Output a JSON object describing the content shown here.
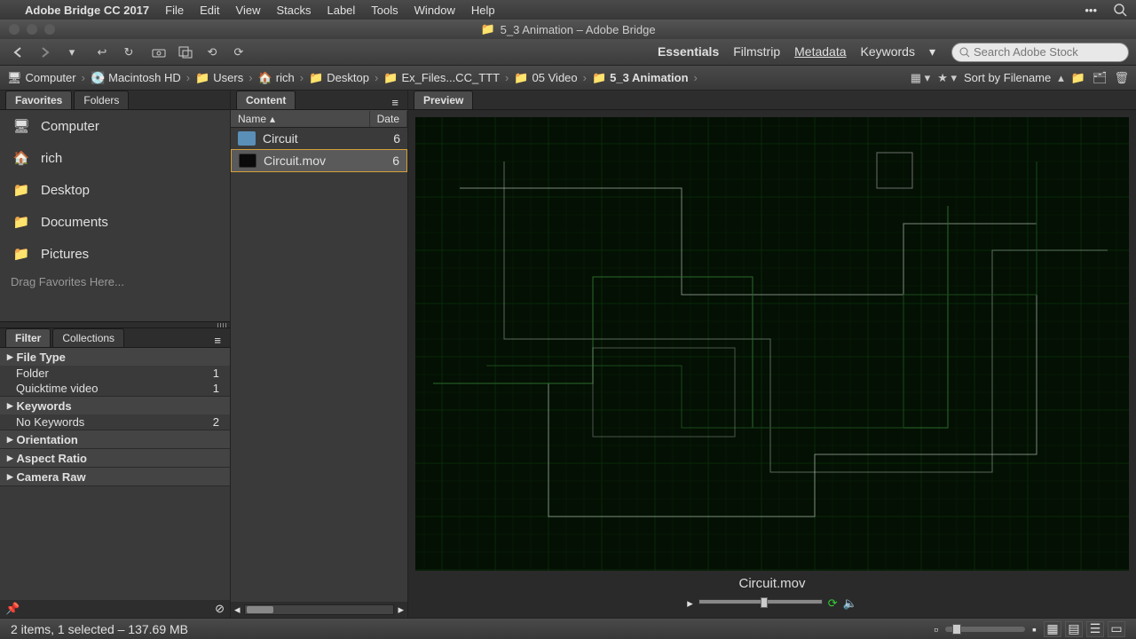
{
  "menubar": {
    "app": "Adobe Bridge CC 2017",
    "items": [
      "File",
      "Edit",
      "View",
      "Stacks",
      "Label",
      "Tools",
      "Window",
      "Help"
    ]
  },
  "titlebar": {
    "folder": "5_3 Animation",
    "app": "Adobe Bridge"
  },
  "workspaces": [
    "Essentials",
    "Filmstrip",
    "Metadata",
    "Keywords"
  ],
  "active_workspace": "Essentials",
  "search": {
    "placeholder": "Search Adobe Stock"
  },
  "breadcrumb": [
    {
      "icon": "display-icon",
      "label": "Computer"
    },
    {
      "icon": "drive-icon",
      "label": "Macintosh HD"
    },
    {
      "icon": "folder-icon",
      "label": "Users"
    },
    {
      "icon": "home-icon",
      "label": "rich"
    },
    {
      "icon": "folder-icon",
      "label": "Desktop"
    },
    {
      "icon": "folder-icon",
      "label": "Ex_Files...CC_TTT"
    },
    {
      "icon": "folder-icon",
      "label": "05 Video"
    },
    {
      "icon": "folder-icon",
      "label": "5_3 Animation"
    }
  ],
  "sort_label": "Sort by Filename",
  "panels": {
    "favorites": {
      "tabs": [
        "Favorites",
        "Folders"
      ],
      "active": "Favorites"
    },
    "filter": {
      "tabs": [
        "Filter",
        "Collections"
      ],
      "active": "Filter"
    },
    "content": {
      "tabs": [
        "Content"
      ],
      "active": "Content"
    },
    "preview": {
      "tabs": [
        "Preview"
      ],
      "active": "Preview"
    }
  },
  "favorites_items": [
    {
      "icon": "display-icon",
      "label": "Computer"
    },
    {
      "icon": "home-icon",
      "label": "rich"
    },
    {
      "icon": "folder-icon",
      "label": "Desktop"
    },
    {
      "icon": "folder-icon",
      "label": "Documents"
    },
    {
      "icon": "folder-icon",
      "label": "Pictures"
    }
  ],
  "favorites_drag_hint": "Drag Favorites Here...",
  "content": {
    "columns": [
      "Name",
      "Date"
    ],
    "sort_col": "Name",
    "rows": [
      {
        "type": "folder",
        "name": "Circuit",
        "date": "6"
      },
      {
        "type": "video",
        "name": "Circuit.mov",
        "date": "6"
      }
    ],
    "selected_index": 1
  },
  "filter": {
    "groups": [
      {
        "title": "File Type",
        "expanded": true,
        "rows": [
          {
            "label": "Folder",
            "count": 1
          },
          {
            "label": "Quicktime video",
            "count": 1
          }
        ]
      },
      {
        "title": "Keywords",
        "expanded": true,
        "rows": [
          {
            "label": "No Keywords",
            "count": 2
          }
        ]
      },
      {
        "title": "Orientation",
        "expanded": false,
        "rows": []
      },
      {
        "title": "Aspect Ratio",
        "expanded": false,
        "rows": []
      },
      {
        "title": "Camera Raw",
        "expanded": false,
        "rows": []
      }
    ]
  },
  "preview": {
    "filename": "Circuit.mov"
  },
  "statusbar": {
    "text": "2 items, 1 selected – 137.69 MB"
  }
}
